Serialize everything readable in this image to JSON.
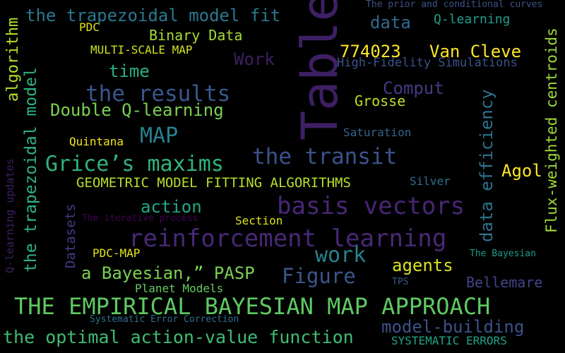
{
  "background": "#000000",
  "words": [
    {
      "id": "w01",
      "text": "Table",
      "color": "#3e1f64"
    },
    {
      "id": "w02",
      "text": "THE EMPIRICAL BAYESIAN MAP APPROACH",
      "color": "#5ec962"
    },
    {
      "id": "w03",
      "text": "reinforcement learning",
      "color": "#482878"
    },
    {
      "id": "w04",
      "text": "the optimal action-value function",
      "color": "#3fbc73"
    },
    {
      "id": "w05",
      "text": "basis vectors",
      "color": "#482677"
    },
    {
      "id": "w06",
      "text": "the results",
      "color": "#39568c"
    },
    {
      "id": "w07",
      "text": "Grice’s maxims",
      "color": "#2fb47c"
    },
    {
      "id": "w08",
      "text": "the transit",
      "color": "#3b528b"
    },
    {
      "id": "w09",
      "text": "the trapezoidal model fit",
      "color": "#2a788e"
    },
    {
      "id": "w10",
      "text": "the trapezoidal model",
      "color": "#2db27d"
    },
    {
      "id": "w11",
      "text": "data efficiency",
      "color": "#2c728e"
    },
    {
      "id": "w12",
      "text": "Flux-weighted centroids",
      "color": "#a0da39"
    },
    {
      "id": "w13",
      "text": "algorithm",
      "color": "#b5de2b"
    },
    {
      "id": "w14",
      "text": "Q-learning updates",
      "color": "#3e1f64"
    },
    {
      "id": "w15",
      "text": "Datasets",
      "color": "#443a83"
    },
    {
      "id": "w16",
      "text": "MAP",
      "color": "#27808e"
    },
    {
      "id": "w17",
      "text": "work",
      "color": "#26828e"
    },
    {
      "id": "w18",
      "text": "Figure",
      "color": "#39568c"
    },
    {
      "id": "w19",
      "text": "Work",
      "color": "#3e1f64"
    },
    {
      "id": "w20",
      "text": "data",
      "color": "#31688e"
    },
    {
      "id": "w21",
      "text": "774023",
      "color": "#fde725"
    },
    {
      "id": "w22",
      "text": "Van Cleve",
      "color": "#fde725"
    },
    {
      "id": "w23",
      "text": "Comput",
      "color": "#443a83"
    },
    {
      "id": "w24",
      "text": "Double Q-learning",
      "color": "#7ad151"
    },
    {
      "id": "w25",
      "text": "a Bayesian,” PASP",
      "color": "#7ad151"
    },
    {
      "id": "w26",
      "text": "model-building",
      "color": "#3b528b"
    },
    {
      "id": "w27",
      "text": "Agol",
      "color": "#fde725"
    },
    {
      "id": "w28",
      "text": "agents",
      "color": "#dce319"
    },
    {
      "id": "w29",
      "text": "action",
      "color": "#22a884"
    },
    {
      "id": "w30",
      "text": "time",
      "color": "#2ab07f"
    },
    {
      "id": "w31",
      "text": "Bellemare",
      "color": "#414487"
    },
    {
      "id": "w32",
      "text": "Binary Data",
      "color": "#a5db36"
    },
    {
      "id": "w33",
      "text": "GEOMETRIC MODEL FITTING ALGORITHMS",
      "color": "#b8de29"
    },
    {
      "id": "w34",
      "text": "Grosse",
      "color": "#c2df23"
    },
    {
      "id": "w35",
      "text": "Q-learning",
      "color": "#1f9e89"
    },
    {
      "id": "w36",
      "text": "High-Fidelity Simulations",
      "color": "#3b528b"
    },
    {
      "id": "w37",
      "text": "MULTI-SCALE MAP",
      "color": "#d2e21b"
    },
    {
      "id": "w38",
      "text": "Planet Models",
      "color": "#65cb5e"
    },
    {
      "id": "w39",
      "text": "Saturation",
      "color": "#33638d"
    },
    {
      "id": "w40",
      "text": "SYSTEMATIC ERRORS",
      "color": "#20a486"
    },
    {
      "id": "w41",
      "text": "Section",
      "color": "#d8e219"
    },
    {
      "id": "w42",
      "text": "Silver",
      "color": "#2d708e"
    },
    {
      "id": "w43",
      "text": "PDC",
      "color": "#e5e419"
    },
    {
      "id": "w44",
      "text": "PDC-MAP",
      "color": "#e7e419"
    },
    {
      "id": "w45",
      "text": "Quintana",
      "color": "#f1e51d"
    },
    {
      "id": "w46",
      "text": "The prior and conditional curves",
      "color": "#3b528b"
    },
    {
      "id": "w47",
      "text": "The iterative process",
      "color": "#440154"
    },
    {
      "id": "w48",
      "text": "The Bayesian",
      "color": "#1f9a8a"
    },
    {
      "id": "w49",
      "text": "Systematic Error Correction",
      "color": "#2e6f8e"
    },
    {
      "id": "w50",
      "text": "TPS",
      "color": "#3b528b"
    }
  ]
}
